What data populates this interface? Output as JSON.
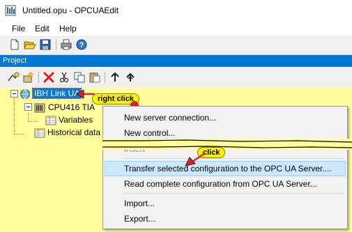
{
  "window": {
    "title": "Untitled.opu - OPCUAEdit",
    "app_icon": "opcua-app-icon"
  },
  "menubar": {
    "items": [
      "File",
      "Edit",
      "Help"
    ]
  },
  "toolbar": {
    "icons": [
      "new-file-icon",
      "open-folder-icon",
      "save-icon",
      "print-icon",
      "help-icon"
    ]
  },
  "project_panel": {
    "title": "Project"
  },
  "project_toolbar": {
    "icons": [
      "add-connection-icon",
      "add-item-icon",
      "delete-icon",
      "cut-icon",
      "copy-icon",
      "paste-icon",
      "move-up-icon",
      "move-top-icon"
    ]
  },
  "tree": {
    "server": "IBH Link UA",
    "control": "CPU416 TIA",
    "variables": "Variables",
    "historical": "Historical data"
  },
  "annotations": {
    "right_click": "right click",
    "click": "click"
  },
  "context_menu": {
    "new_server": "New server connection...",
    "new_control": "New control...",
    "insert": "Insert",
    "transfer": "Transfer selected configuration to the OPC UA Server....",
    "read": "Read complete configuration from OPC UA Server...",
    "import": "Import...",
    "export": "Export..."
  },
  "colors": {
    "background": "#fffe9b",
    "selection": "#0078d7",
    "callout": "#fff200",
    "highlight": "#cce8ff",
    "red": "#e31d2b"
  }
}
